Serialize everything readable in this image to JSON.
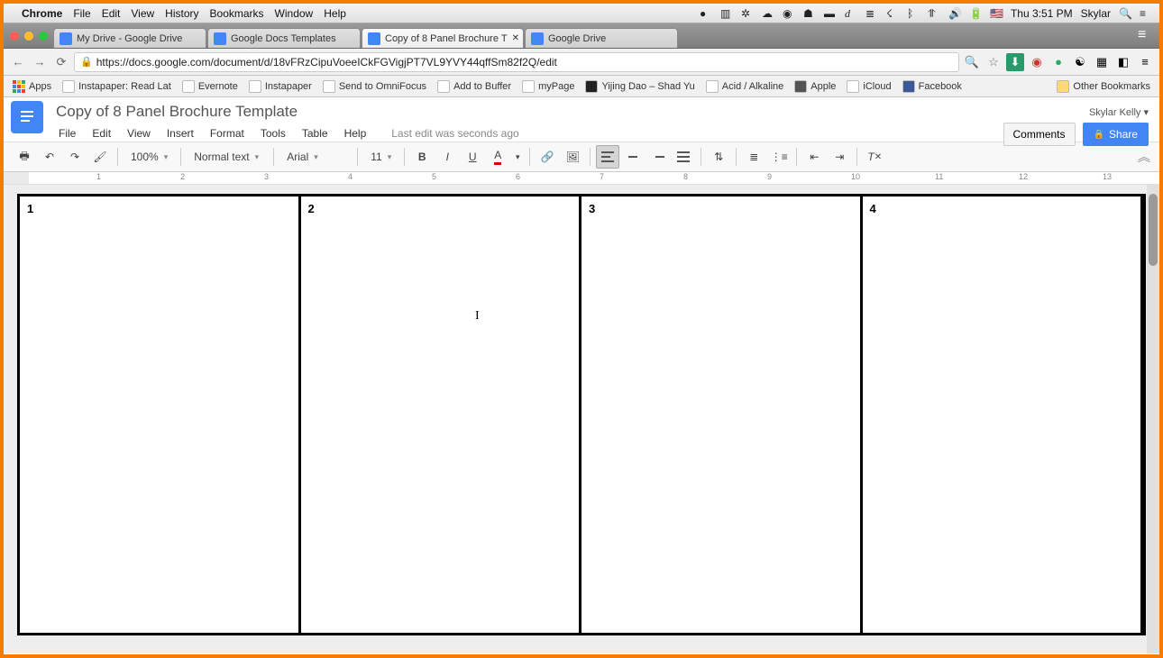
{
  "osx": {
    "app": "Chrome",
    "menus": [
      "File",
      "Edit",
      "View",
      "History",
      "Bookmarks",
      "Window",
      "Help"
    ],
    "time": "Thu 3:51 PM",
    "user": "Skylar"
  },
  "browser": {
    "tabs": [
      "My Drive - Google Drive",
      "Google Docs Templates",
      "Copy of 8 Panel Brochure T",
      "Google Drive"
    ],
    "active_tab": 2,
    "url": "https://docs.google.com/document/d/18vFRzCipuVoeeICkFGVigjPT7VL9YVY44qffSm82f2Q/edit",
    "bookmarks_btn": "Apps",
    "bookmarks": [
      "Instapaper: Read Lat",
      "Evernote",
      "Instapaper",
      "Send to OmniFocus",
      "Add to Buffer",
      "myPage",
      "Yijing Dao – Shad Yu",
      "Acid / Alkaline",
      "Apple",
      "iCloud",
      "Facebook"
    ],
    "other_bookmarks": "Other Bookmarks"
  },
  "docs": {
    "title": "Copy of 8 Panel Brochure Template",
    "menus": [
      "File",
      "Edit",
      "View",
      "Insert",
      "Format",
      "Tools",
      "Table",
      "Help"
    ],
    "last_edit": "Last edit was seconds ago",
    "user": "Skylar Kelly",
    "comments": "Comments",
    "share": "Share",
    "toolbar": {
      "zoom": "100%",
      "style": "Normal text",
      "font": "Arial",
      "size": "11"
    },
    "panels": [
      "1",
      "2",
      "3",
      "4"
    ],
    "ruler_marks": [
      "1",
      "2",
      "3",
      "4",
      "5",
      "6",
      "7",
      "8",
      "9",
      "10",
      "11",
      "12",
      "13"
    ]
  }
}
